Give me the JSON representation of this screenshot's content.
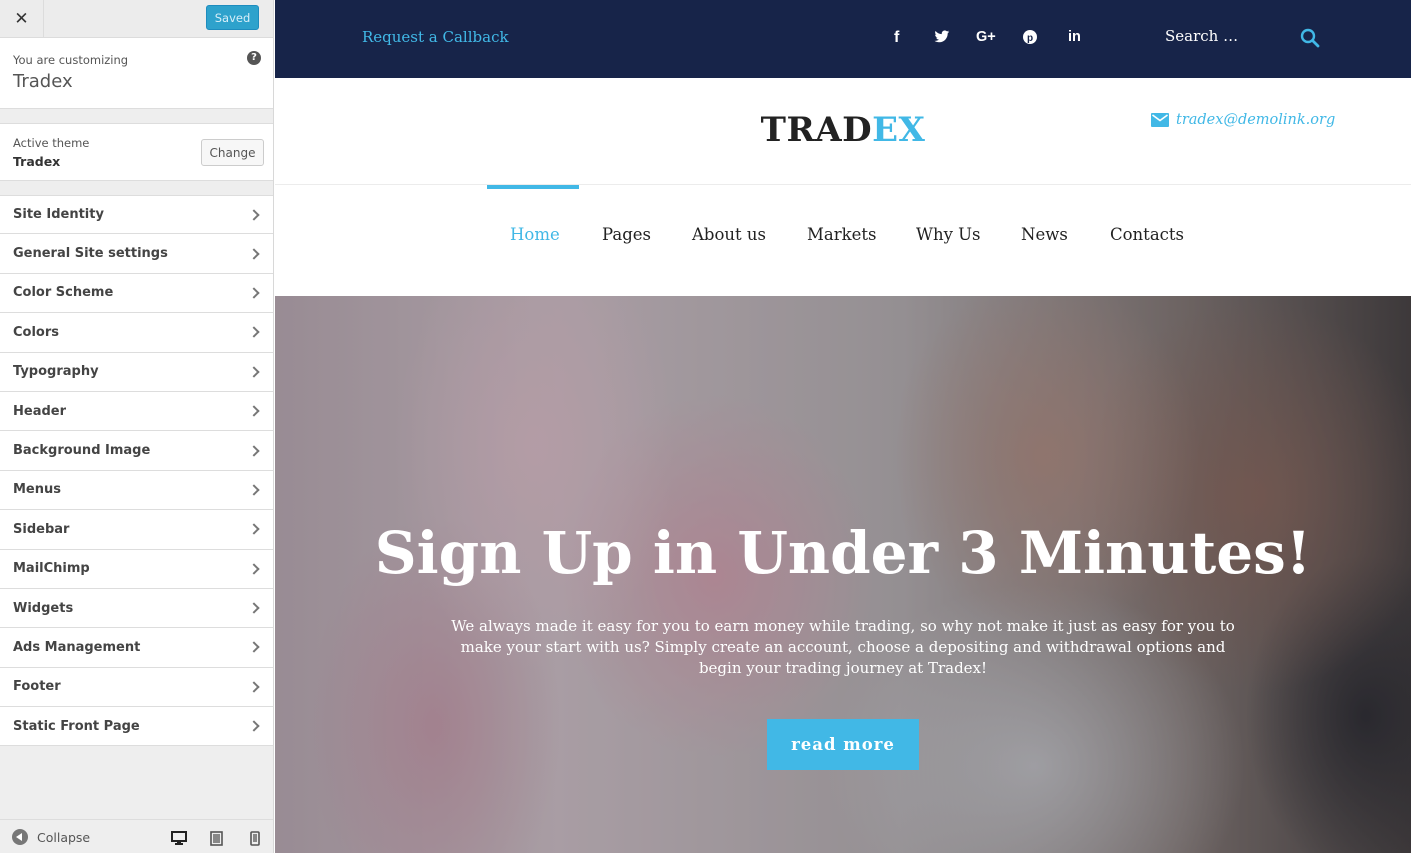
{
  "customizer": {
    "close_icon": "close-icon",
    "saved_label": "Saved",
    "customizing_label": "You are customizing",
    "site_name": "Tradex",
    "help_icon": "help-icon",
    "active_theme_label": "Active theme",
    "active_theme_name": "Tradex",
    "change_label": "Change",
    "sections": [
      "Site Identity",
      "General Site settings",
      "Color Scheme",
      "Colors",
      "Typography",
      "Header",
      "Background Image",
      "Menus",
      "Sidebar",
      "MailChimp",
      "Widgets",
      "Ads Management",
      "Footer",
      "Static Front Page"
    ],
    "collapse_label": "Collapse",
    "device_icons": [
      "desktop-icon",
      "tablet-icon",
      "mobile-icon"
    ]
  },
  "site": {
    "topbar": {
      "callback_label": "Request a Callback",
      "social_icons": [
        "facebook-icon",
        "twitter-icon",
        "google-plus-icon",
        "pinterest-icon",
        "linkedin-icon"
      ],
      "search_placeholder": "Search …"
    },
    "logo": {
      "part1": "TRAD",
      "part2": "EX"
    },
    "email": "tradex@demolink.org",
    "nav": [
      "Home",
      "Pages",
      "About us",
      "Markets",
      "Why Us",
      "News",
      "Contacts"
    ],
    "nav_active": "Home",
    "hero": {
      "title": "Sign Up in Under 3 Minutes!",
      "text": "We always made it easy for you to earn money while trading, so why not make it just as easy for you to make your start with us? Simply create an account, choose a depositing and withdrawal options and begin your trading journey at Tradex!",
      "button_label": "read more"
    }
  },
  "colors": {
    "accent": "#41b8e6",
    "topbar_bg": "#172449",
    "wp_blue": "#2ea2cc"
  }
}
